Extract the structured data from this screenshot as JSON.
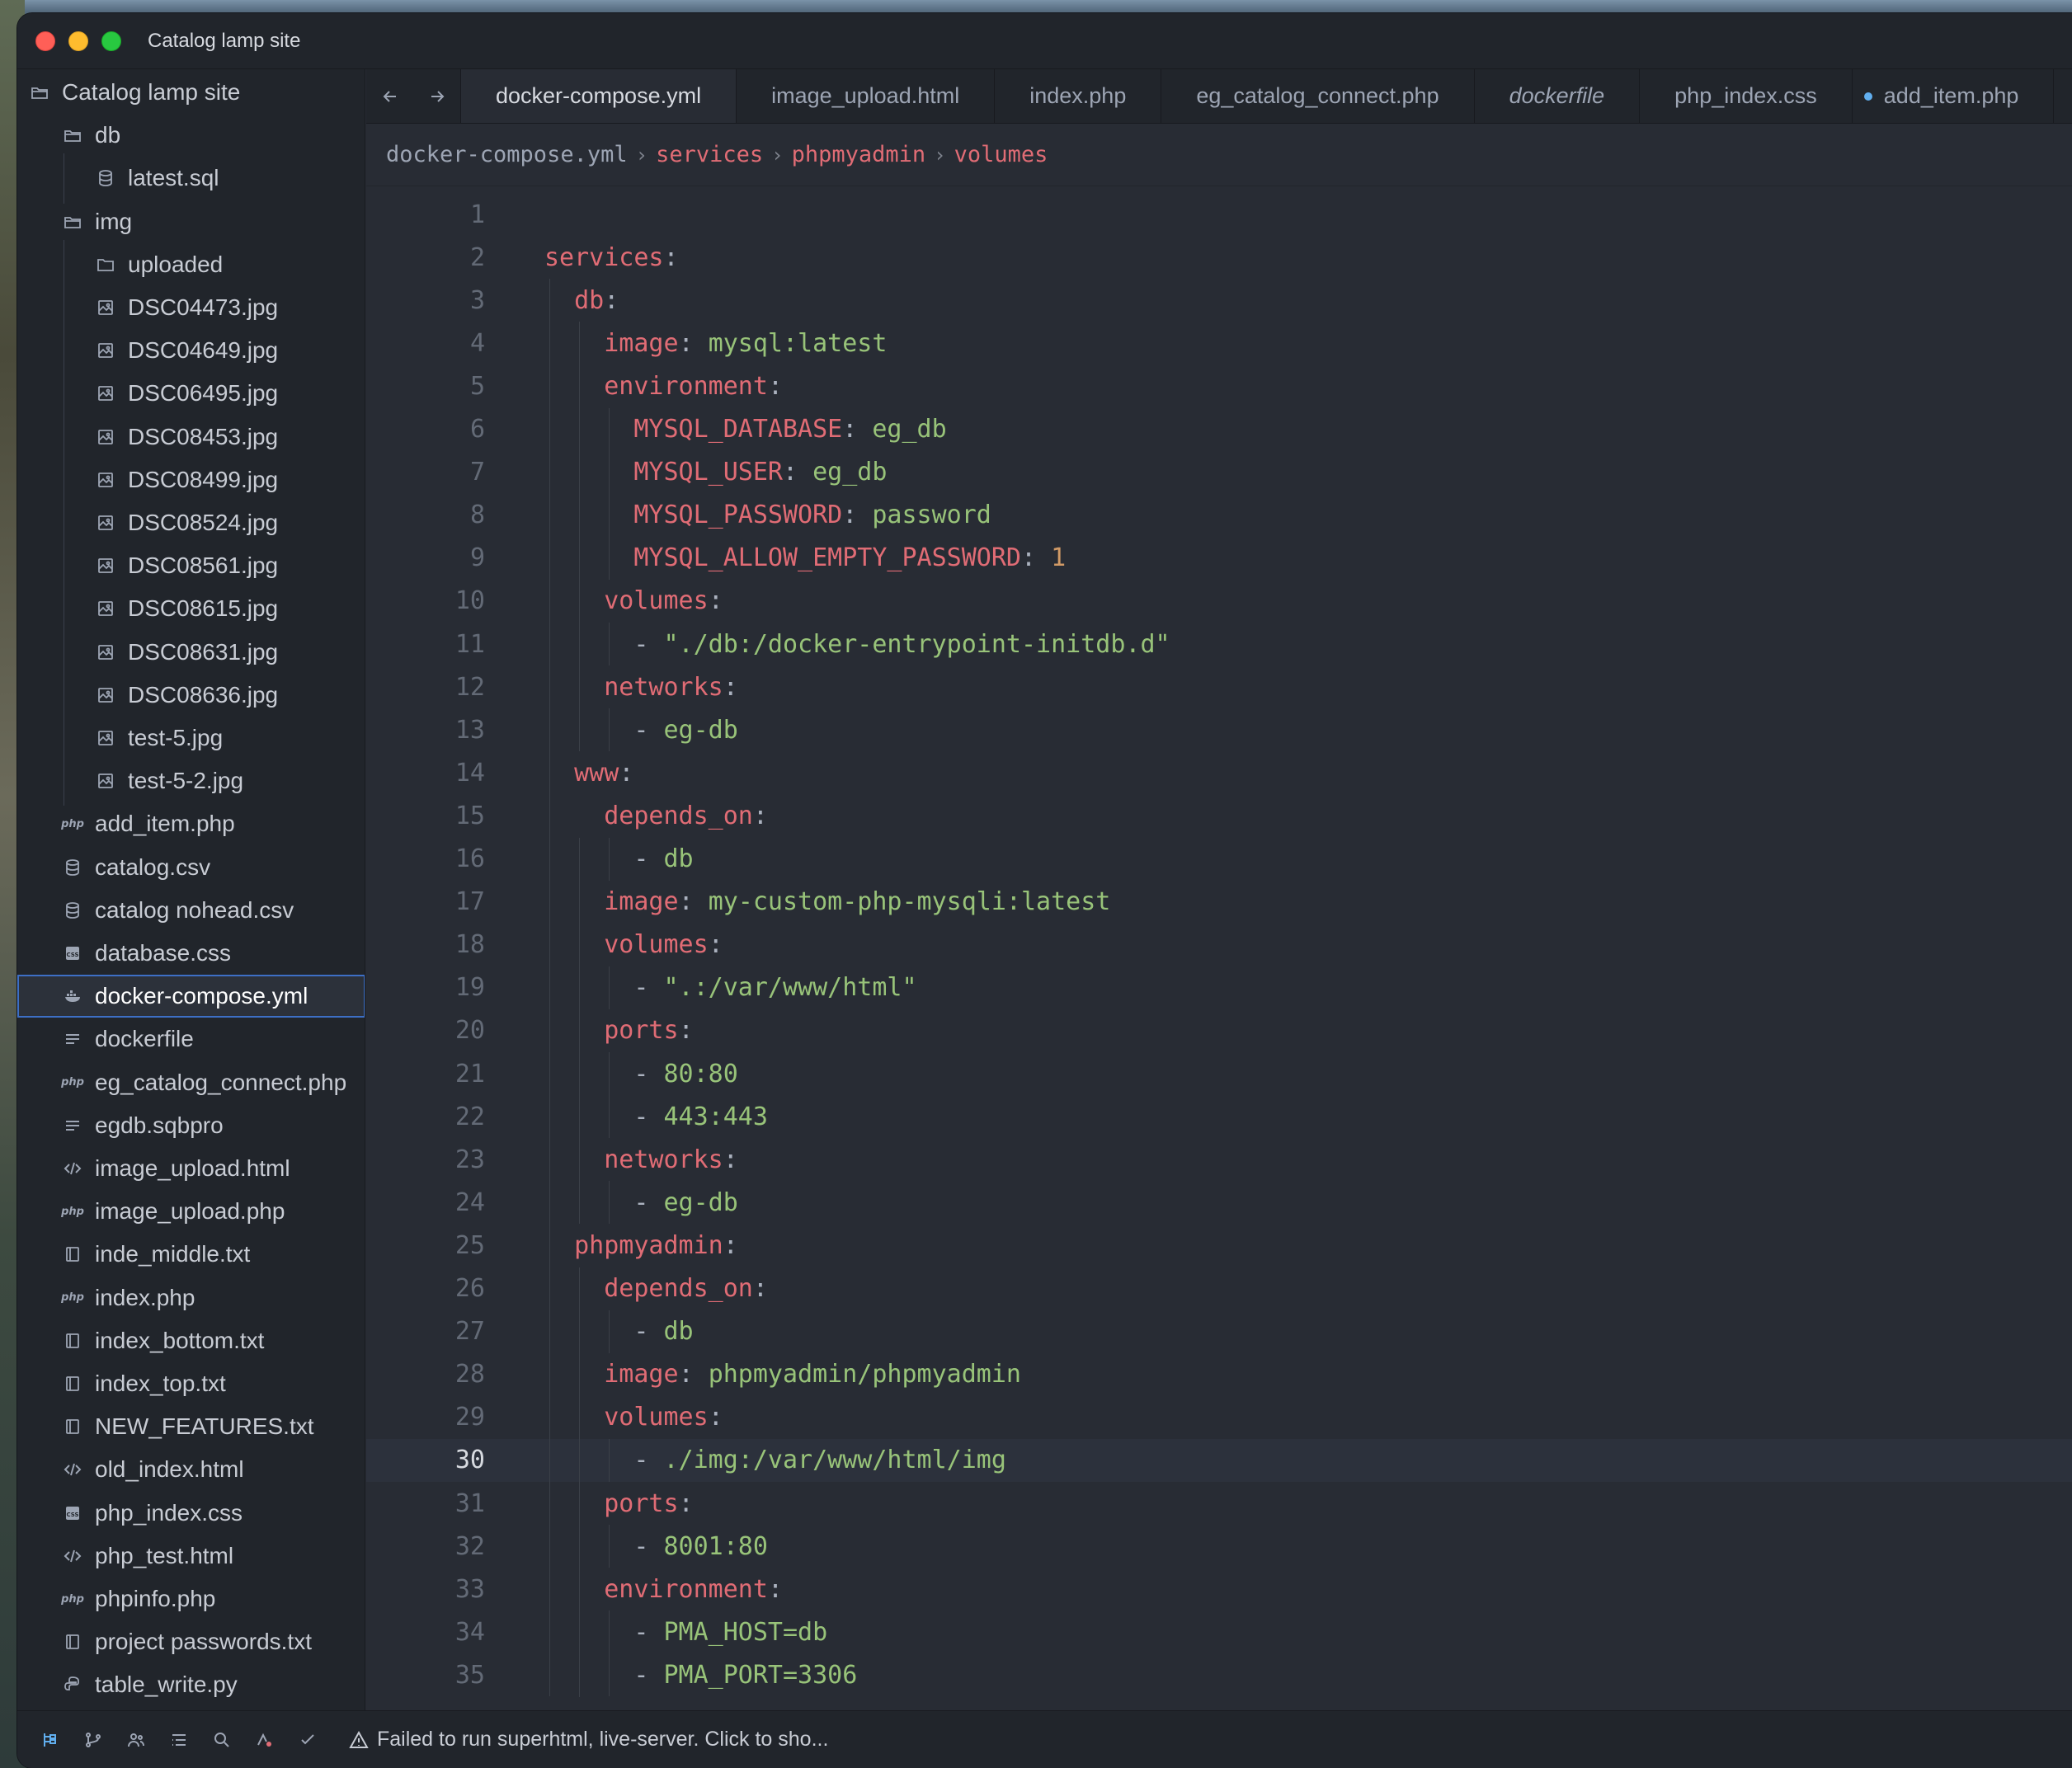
{
  "window": {
    "title": "Catalog lamp site"
  },
  "sidebar": {
    "root": "Catalog lamp site",
    "items": [
      {
        "label": "db",
        "icon": "folder-open-icon",
        "depth": 1
      },
      {
        "label": "latest.sql",
        "icon": "database-icon",
        "depth": 2
      },
      {
        "label": "img",
        "icon": "folder-open-icon",
        "depth": 1
      },
      {
        "label": "uploaded",
        "icon": "folder-icon",
        "depth": 2
      },
      {
        "label": "DSC04473.jpg",
        "icon": "image-icon",
        "depth": 2
      },
      {
        "label": "DSC04649.jpg",
        "icon": "image-icon",
        "depth": 2
      },
      {
        "label": "DSC06495.jpg",
        "icon": "image-icon",
        "depth": 2
      },
      {
        "label": "DSC08453.jpg",
        "icon": "image-icon",
        "depth": 2
      },
      {
        "label": "DSC08499.jpg",
        "icon": "image-icon",
        "depth": 2
      },
      {
        "label": "DSC08524.jpg",
        "icon": "image-icon",
        "depth": 2
      },
      {
        "label": "DSC08561.jpg",
        "icon": "image-icon",
        "depth": 2
      },
      {
        "label": "DSC08615.jpg",
        "icon": "image-icon",
        "depth": 2
      },
      {
        "label": "DSC08631.jpg",
        "icon": "image-icon",
        "depth": 2
      },
      {
        "label": "DSC08636.jpg",
        "icon": "image-icon",
        "depth": 2
      },
      {
        "label": "test-5.jpg",
        "icon": "image-icon",
        "depth": 2
      },
      {
        "label": "test-5-2.jpg",
        "icon": "image-icon",
        "depth": 2
      },
      {
        "label": "add_item.php",
        "icon": "php-icon",
        "depth": 1
      },
      {
        "label": "catalog.csv",
        "icon": "database-icon",
        "depth": 1
      },
      {
        "label": "catalog nohead.csv",
        "icon": "database-icon",
        "depth": 1
      },
      {
        "label": "database.css",
        "icon": "css-icon",
        "depth": 1
      },
      {
        "label": "docker-compose.yml",
        "icon": "docker-icon",
        "depth": 1,
        "selected": true
      },
      {
        "label": "dockerfile",
        "icon": "text-lines-icon",
        "depth": 1
      },
      {
        "label": "eg_catalog_connect.php",
        "icon": "php-icon",
        "depth": 1
      },
      {
        "label": "egdb.sqbpro",
        "icon": "text-lines-icon",
        "depth": 1
      },
      {
        "label": "image_upload.html",
        "icon": "code-icon",
        "depth": 1
      },
      {
        "label": "image_upload.php",
        "icon": "php-icon",
        "depth": 1
      },
      {
        "label": "inde_middle.txt",
        "icon": "book-icon",
        "depth": 1
      },
      {
        "label": "index.php",
        "icon": "php-icon",
        "depth": 1
      },
      {
        "label": "index_bottom.txt",
        "icon": "book-icon",
        "depth": 1
      },
      {
        "label": "index_top.txt",
        "icon": "book-icon",
        "depth": 1
      },
      {
        "label": "NEW_FEATURES.txt",
        "icon": "book-icon",
        "depth": 1
      },
      {
        "label": "old_index.html",
        "icon": "code-icon",
        "depth": 1
      },
      {
        "label": "php_index.css",
        "icon": "css-icon",
        "depth": 1
      },
      {
        "label": "php_test.html",
        "icon": "code-icon",
        "depth": 1
      },
      {
        "label": "phpinfo.php",
        "icon": "php-icon",
        "depth": 1
      },
      {
        "label": "project  passwords.txt",
        "icon": "book-icon",
        "depth": 1
      },
      {
        "label": "table_write.py",
        "icon": "python-icon",
        "depth": 1
      }
    ]
  },
  "tabs": [
    {
      "label": "docker-compose.yml",
      "active": true
    },
    {
      "label": "image_upload.html"
    },
    {
      "label": "index.php"
    },
    {
      "label": "eg_catalog_connect.php"
    },
    {
      "label": "dockerfile",
      "italic": true
    },
    {
      "label": "php_index.css"
    },
    {
      "label": "add_item.php",
      "modified": true
    }
  ],
  "breadcrumb": {
    "file": "docker-compose.yml",
    "path": [
      "services",
      "phpmyadmin",
      "volumes"
    ]
  },
  "editor": {
    "current_line": 30,
    "lines": [
      [],
      [
        {
          "t": "services",
          "c": "k"
        },
        {
          "t": ":",
          "c": "p"
        }
      ],
      [
        {
          "t": "  "
        },
        {
          "t": "db",
          "c": "k"
        },
        {
          "t": ":",
          "c": "p"
        }
      ],
      [
        {
          "t": "    "
        },
        {
          "t": "image",
          "c": "k"
        },
        {
          "t": ": ",
          "c": "p"
        },
        {
          "t": "mysql:latest",
          "c": "v"
        }
      ],
      [
        {
          "t": "    "
        },
        {
          "t": "environment",
          "c": "k"
        },
        {
          "t": ":",
          "c": "p"
        }
      ],
      [
        {
          "t": "      "
        },
        {
          "t": "MYSQL_DATABASE",
          "c": "k"
        },
        {
          "t": ": ",
          "c": "p"
        },
        {
          "t": "eg_db",
          "c": "v"
        }
      ],
      [
        {
          "t": "      "
        },
        {
          "t": "MYSQL_USER",
          "c": "k"
        },
        {
          "t": ": ",
          "c": "p"
        },
        {
          "t": "eg_db",
          "c": "v"
        }
      ],
      [
        {
          "t": "      "
        },
        {
          "t": "MYSQL_PASSWORD",
          "c": "k"
        },
        {
          "t": ": ",
          "c": "p"
        },
        {
          "t": "password",
          "c": "v"
        }
      ],
      [
        {
          "t": "      "
        },
        {
          "t": "MYSQL_ALLOW_EMPTY_PASSWORD",
          "c": "k"
        },
        {
          "t": ": ",
          "c": "p"
        },
        {
          "t": "1",
          "c": "n"
        }
      ],
      [
        {
          "t": "    "
        },
        {
          "t": "volumes",
          "c": "k"
        },
        {
          "t": ":",
          "c": "p"
        }
      ],
      [
        {
          "t": "      "
        },
        {
          "t": "- ",
          "c": "p"
        },
        {
          "t": "\"./db:/docker-entrypoint-initdb.d\"",
          "c": "v"
        }
      ],
      [
        {
          "t": "    "
        },
        {
          "t": "networks",
          "c": "k"
        },
        {
          "t": ":",
          "c": "p"
        }
      ],
      [
        {
          "t": "      "
        },
        {
          "t": "- ",
          "c": "p"
        },
        {
          "t": "eg-db",
          "c": "v"
        }
      ],
      [
        {
          "t": "  "
        },
        {
          "t": "www",
          "c": "k"
        },
        {
          "t": ":",
          "c": "p"
        }
      ],
      [
        {
          "t": "    "
        },
        {
          "t": "depends_on",
          "c": "k"
        },
        {
          "t": ":",
          "c": "p"
        }
      ],
      [
        {
          "t": "      "
        },
        {
          "t": "- ",
          "c": "p"
        },
        {
          "t": "db",
          "c": "v"
        }
      ],
      [
        {
          "t": "    "
        },
        {
          "t": "image",
          "c": "k"
        },
        {
          "t": ": ",
          "c": "p"
        },
        {
          "t": "my-custom-php-mysqli:latest",
          "c": "v"
        }
      ],
      [
        {
          "t": "    "
        },
        {
          "t": "volumes",
          "c": "k"
        },
        {
          "t": ":",
          "c": "p"
        }
      ],
      [
        {
          "t": "      "
        },
        {
          "t": "- ",
          "c": "p"
        },
        {
          "t": "\".:/var/www/html\"",
          "c": "v"
        }
      ],
      [
        {
          "t": "    "
        },
        {
          "t": "ports",
          "c": "k"
        },
        {
          "t": ":",
          "c": "p"
        }
      ],
      [
        {
          "t": "      "
        },
        {
          "t": "- ",
          "c": "p"
        },
        {
          "t": "80:80",
          "c": "v"
        }
      ],
      [
        {
          "t": "      "
        },
        {
          "t": "- ",
          "c": "p"
        },
        {
          "t": "443:443",
          "c": "v"
        }
      ],
      [
        {
          "t": "    "
        },
        {
          "t": "networks",
          "c": "k"
        },
        {
          "t": ":",
          "c": "p"
        }
      ],
      [
        {
          "t": "      "
        },
        {
          "t": "- ",
          "c": "p"
        },
        {
          "t": "eg-db",
          "c": "v"
        }
      ],
      [
        {
          "t": "  "
        },
        {
          "t": "phpmyadmin",
          "c": "k"
        },
        {
          "t": ":",
          "c": "p"
        }
      ],
      [
        {
          "t": "    "
        },
        {
          "t": "depends_on",
          "c": "k"
        },
        {
          "t": ":",
          "c": "p"
        }
      ],
      [
        {
          "t": "      "
        },
        {
          "t": "- ",
          "c": "p"
        },
        {
          "t": "db",
          "c": "v"
        }
      ],
      [
        {
          "t": "    "
        },
        {
          "t": "image",
          "c": "k"
        },
        {
          "t": ": ",
          "c": "p"
        },
        {
          "t": "phpmyadmin/phpmyadmin",
          "c": "v"
        }
      ],
      [
        {
          "t": "    "
        },
        {
          "t": "volumes",
          "c": "k"
        },
        {
          "t": ":",
          "c": "p"
        }
      ],
      [
        {
          "t": "      "
        },
        {
          "t": "- ",
          "c": "p"
        },
        {
          "t": "./img:/var/www/html/img",
          "c": "v"
        }
      ],
      [
        {
          "t": "    "
        },
        {
          "t": "ports",
          "c": "k"
        },
        {
          "t": ":",
          "c": "p"
        }
      ],
      [
        {
          "t": "      "
        },
        {
          "t": "- ",
          "c": "p"
        },
        {
          "t": "8001:80",
          "c": "v"
        }
      ],
      [
        {
          "t": "    "
        },
        {
          "t": "environment",
          "c": "k"
        },
        {
          "t": ":",
          "c": "p"
        }
      ],
      [
        {
          "t": "      "
        },
        {
          "t": "- ",
          "c": "p"
        },
        {
          "t": "PMA_HOST=db",
          "c": "v"
        }
      ],
      [
        {
          "t": "      "
        },
        {
          "t": "- ",
          "c": "p"
        },
        {
          "t": "PMA_PORT=3306",
          "c": "v"
        }
      ]
    ]
  },
  "statusbar": {
    "icons": [
      "project-panel-icon",
      "git-branch-icon",
      "collab-icon",
      "outline-icon",
      "search-icon",
      "assistant-icon",
      "check-icon"
    ],
    "message": "Failed to run superhtml, live-server. Click to sho..."
  },
  "colors": {
    "key": "#e06c75",
    "string": "#98c379",
    "number": "#d19a66",
    "background": "#282c34",
    "sidebar": "#21252b",
    "selection_outline": "#3d6fc5"
  }
}
